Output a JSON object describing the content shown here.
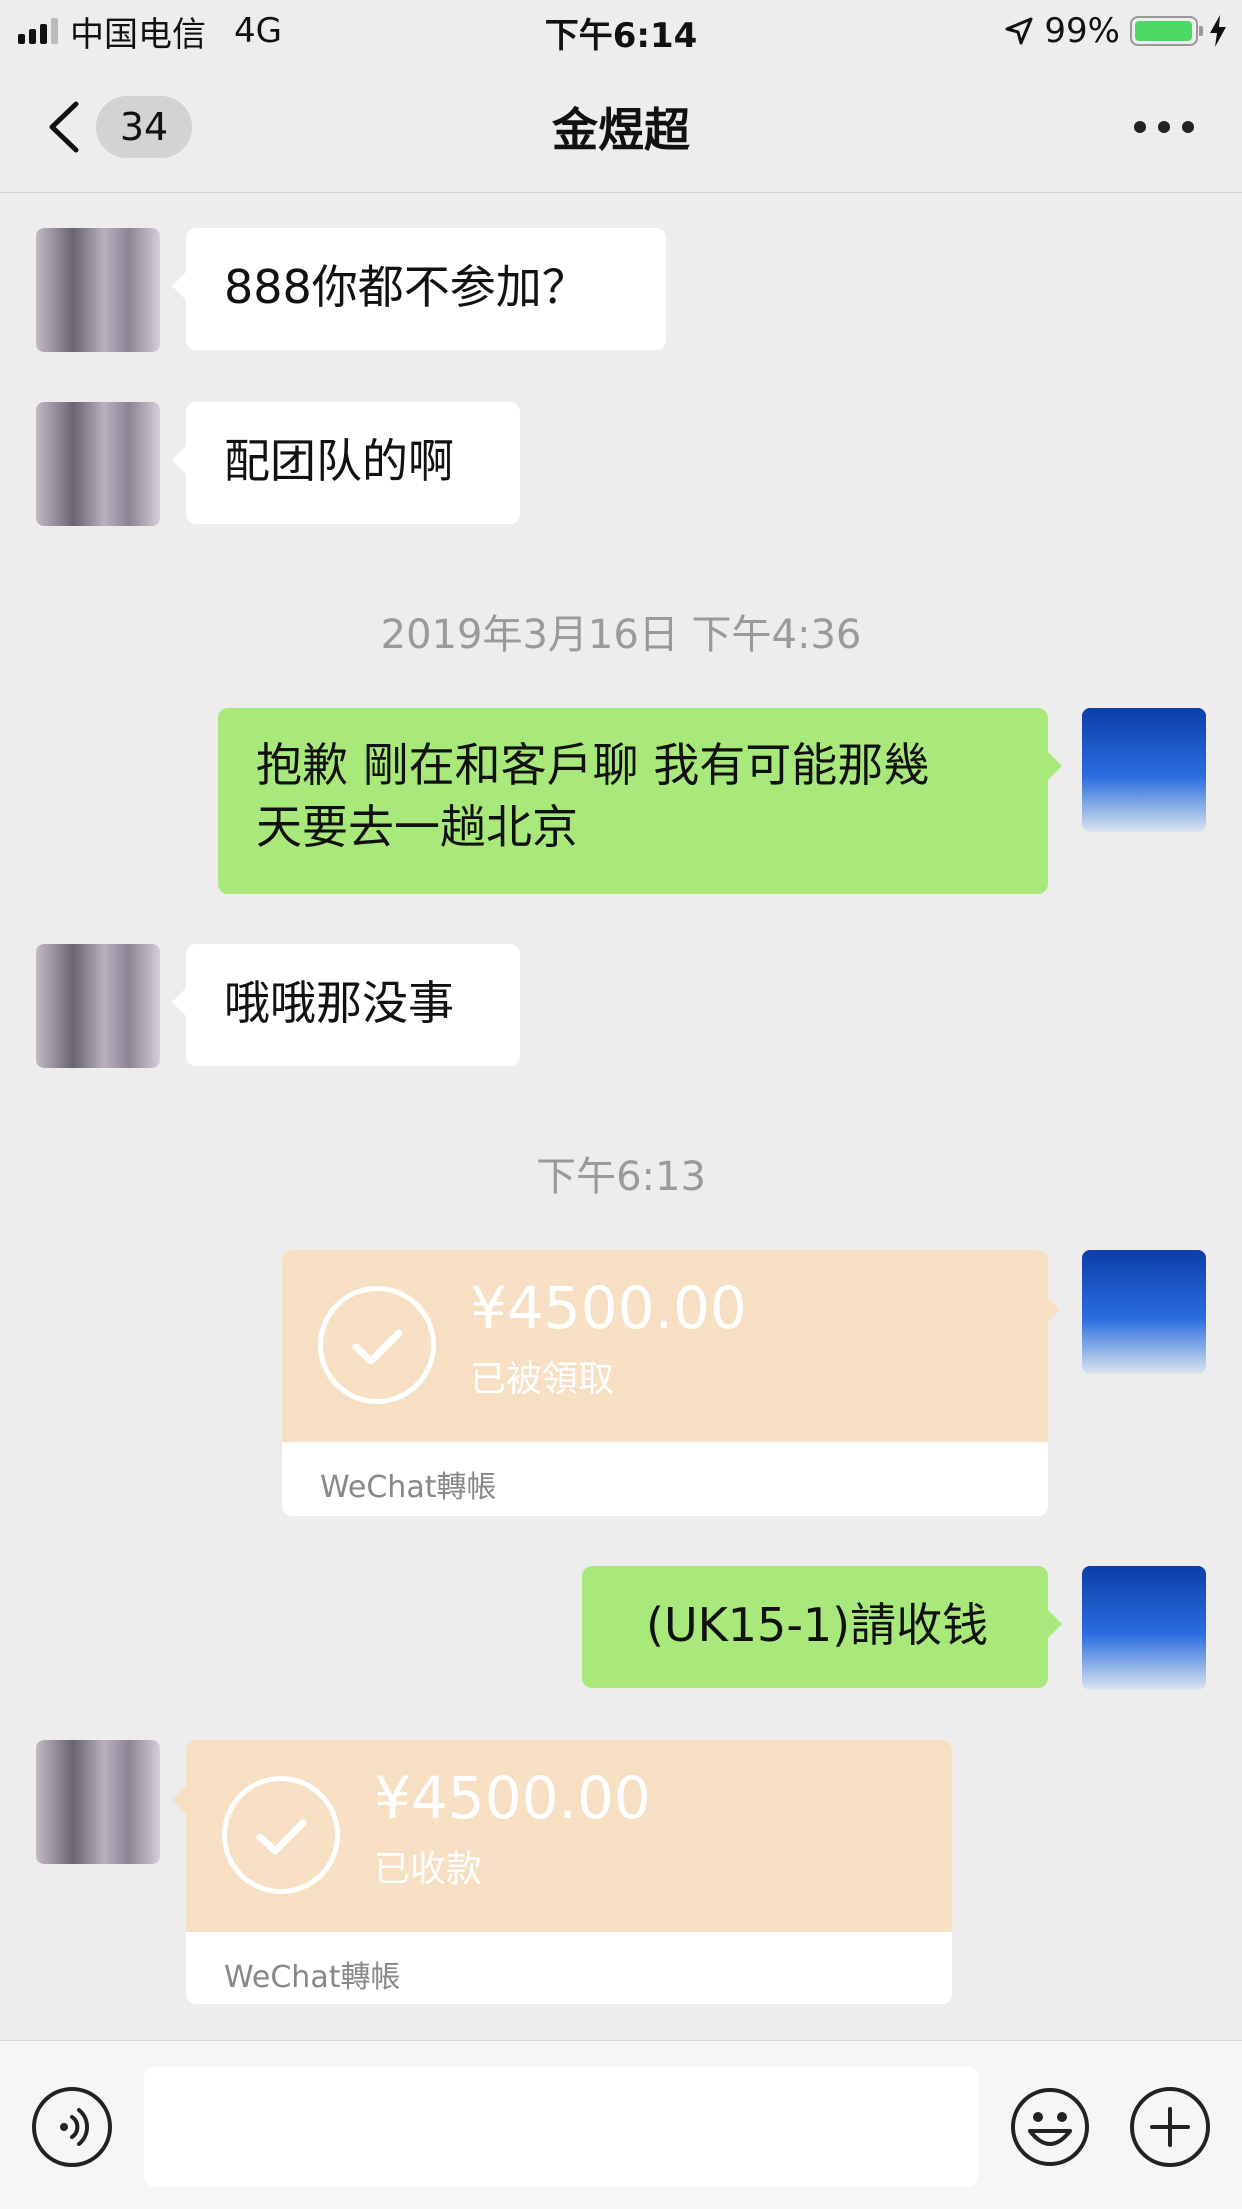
{
  "status_bar": {
    "carrier": "中国电信",
    "network": "4G",
    "time": "下午6:14",
    "battery": "99%",
    "battery_level": 0.99
  },
  "nav": {
    "unread_count": "34",
    "title": "金煜超",
    "icons": [
      "back-chevron-icon",
      "more-icon"
    ]
  },
  "messages": [
    {
      "type": "text",
      "from": "friend",
      "text": "888你都不参加？"
    },
    {
      "type": "text",
      "from": "friend",
      "text": "配团队的啊"
    },
    {
      "type": "timestamp",
      "text": "2019年3月16日 下午4:36"
    },
    {
      "type": "text",
      "from": "me",
      "line1": "抱歉 剛在和客戶聊 我有可能那幾",
      "line2": "天要去一趟北京"
    },
    {
      "type": "text",
      "from": "friend",
      "text": "哦哦那没事"
    },
    {
      "type": "timestamp",
      "text": "下午6:13"
    },
    {
      "type": "transfer",
      "from": "me",
      "amount": "¥4500.00",
      "status": "已被領取",
      "footer": "WeChat轉帳"
    },
    {
      "type": "text",
      "from": "me",
      "text": "(UK15-1)請收钱"
    },
    {
      "type": "transfer",
      "from": "friend",
      "amount": "¥4500.00",
      "status": "已收款",
      "footer": "WeChat轉帳"
    }
  ],
  "input_bar": {
    "placeholder": "",
    "icons": [
      "voice-icon",
      "emoji-icon",
      "plus-icon"
    ]
  },
  "colors": {
    "background": "#ededed",
    "outgoing_bubble": "#a9e87a",
    "incoming_bubble": "#ffffff",
    "transfer_card": "#f7dfc3",
    "battery": "#4cd964"
  }
}
